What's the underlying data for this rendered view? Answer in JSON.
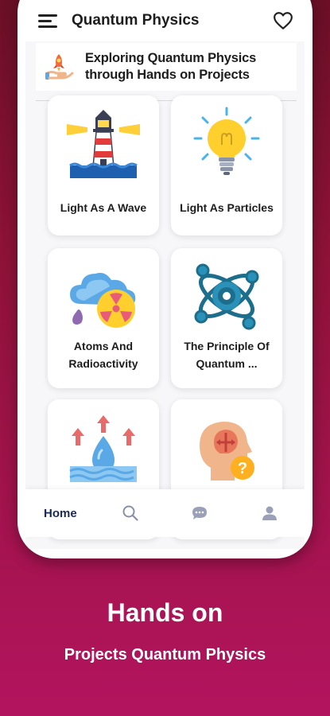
{
  "app": {
    "title": "Quantum Physics"
  },
  "banner": {
    "line1": "Exploring Quantum Physics",
    "line2": "through Hands on Projects"
  },
  "cards": [
    {
      "label": "Light As A Wave",
      "icon": "lighthouse-icon"
    },
    {
      "label": "Light As Particles",
      "icon": "light-bulb-icon"
    },
    {
      "label_line1": "Atoms And",
      "label_line2": "Radioactivity",
      "icon": "cloud-radiation-icon"
    },
    {
      "label_line1": "The Principle Of",
      "label_line2": "Quantum ...",
      "icon": "atom-icon"
    },
    {
      "label": "",
      "icon": "water-drop-icon"
    },
    {
      "label": "",
      "icon": "head-question-icon"
    }
  ],
  "bottom_nav": {
    "home_label": "Home",
    "items": [
      "search-icon",
      "chat-icon",
      "profile-icon"
    ]
  },
  "caption": {
    "title": "Hands on",
    "subtitle": "Projects Quantum Physics"
  },
  "colors": {
    "background_top": "#6a0f26",
    "background_bottom": "#b3145e",
    "nav_active": "#1a2a55"
  }
}
